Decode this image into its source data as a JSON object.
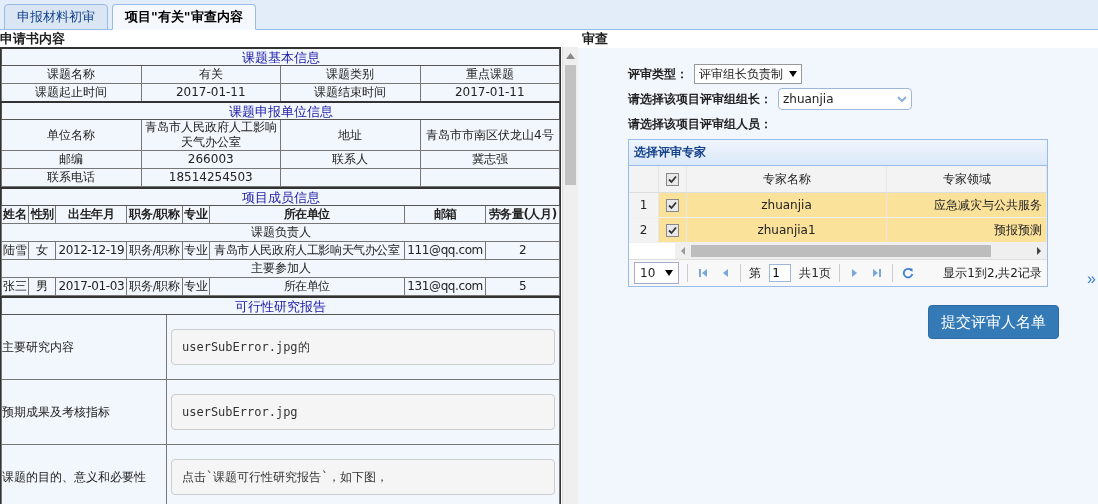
{
  "tabs": [
    {
      "label": "申报材料初审",
      "selected": false
    },
    {
      "label": "项目\"有关\"审查内容",
      "selected": true
    }
  ],
  "application": {
    "title": "申请书内容",
    "basic": {
      "heading": "课题基本信息",
      "rows": [
        [
          "课题名称",
          "有关",
          "课题类别",
          "重点课题"
        ],
        [
          "课题起止时间",
          "2017-01-11",
          "课题结束时间",
          "2017-01-11"
        ]
      ]
    },
    "unit": {
      "heading": "课题申报单位信息",
      "rows": [
        [
          "单位名称",
          "青岛市人民政府人工影响天气办公室",
          "地址",
          "青岛市市南区伏龙山4号"
        ],
        [
          "邮编",
          "266003",
          "联系人",
          "冀志强"
        ],
        [
          "联系电话",
          "18514254503",
          "",
          ""
        ]
      ]
    },
    "members": {
      "heading": "项目成员信息",
      "columns": [
        "姓名",
        "性别",
        "出生年月",
        "职务/职称",
        "专业",
        "所在单位",
        "邮箱",
        "劳务量(人月)"
      ],
      "groups": [
        {
          "label": "课题负责人",
          "rows": [
            [
              "陆雪",
              "女",
              "2012-12-19",
              "职务/职称",
              "专业",
              "青岛市人民政府人工影响天气办公室",
              "111@qq.com",
              "2"
            ]
          ]
        },
        {
          "label": "主要参加人",
          "rows": [
            [
              "张三",
              "男",
              "2017-01-03",
              "职务/职称",
              "专业",
              "所在单位",
              "131@qq.com",
              "5"
            ]
          ]
        }
      ]
    },
    "report": {
      "heading": "可行性研究报告",
      "items": [
        {
          "label": "主要研究内容",
          "value": "userSubError.jpg的"
        },
        {
          "label": "预期成果及考核指标",
          "value": "userSubError.jpg"
        },
        {
          "label": "课题的目的、意义和必要性",
          "value": "点击`课题可行性研究报告`，如下图，"
        }
      ]
    }
  },
  "review": {
    "title": "审查",
    "type_label": "评审类型：",
    "type_value": "评审组长负责制",
    "leader_label": "请选择该项目评审组组长：",
    "leader_value": "zhuanjia",
    "members_label": "请选择该项目评审组人员：",
    "grid": {
      "title": "选择评审专家",
      "all_checked": true,
      "columns": [
        "专家名称",
        "专家领域"
      ],
      "rows": [
        {
          "index": "1",
          "checked": true,
          "selected": true,
          "name": "zhuanjia",
          "field": "应急减灾与公共服务"
        },
        {
          "index": "2",
          "checked": true,
          "selected": true,
          "name": "zhuanjia1",
          "field": "预报预测"
        }
      ],
      "pager": {
        "page_size": "10",
        "page_prefix": "第",
        "page": "1",
        "page_total": "共1页",
        "summary": "显示1到2,共2记录"
      }
    },
    "submit": "提交评审人名单",
    "expand": "»"
  }
}
